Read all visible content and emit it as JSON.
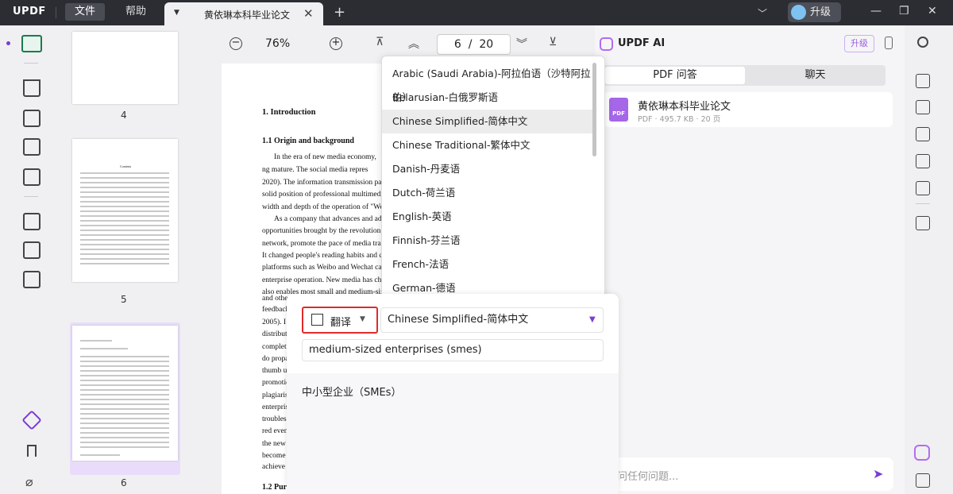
{
  "app": {
    "logo": "UPDF",
    "menu_file": "文件",
    "menu_help": "帮助",
    "tab_title": "黄依琳本科毕业论文",
    "upgrade": "升级"
  },
  "toolbar": {
    "zoom": "76%",
    "page_current": "6",
    "page_sep": "/",
    "page_total": "20"
  },
  "thumbnails": [
    {
      "num": "4"
    },
    {
      "num": "5"
    },
    {
      "num": "6"
    }
  ],
  "thumb5_title": "Contents",
  "document": {
    "heading1": "1. Introduction",
    "heading11": "1.1 Origin and background",
    "heading12": "1.2 Pur",
    "lines": [
      "In the era of new media economy,",
      "ng mature. The social media repres",
      "2020). The information transmission patte",
      "solid position of professional multimedia",
      "width and depth of the operation of \"We me",
      "As a company that advances and adv",
      "opportunities brought by the revolution, rel",
      "network, promote the pace of media transf",
      "It changed people's reading habits and creat",
      "platforms such as Weibo and Wechat ca",
      "enterprise operation. New media has chang",
      "also enables most small and medium-sized",
      "feedback",
      "and othe",
      "2005). I",
      "distribut",
      "complete",
      "do propa",
      "thumb up",
      "promotic",
      "plagiaris",
      "enterpris",
      "troubles,",
      "red even",
      "the new",
      "become",
      "achieve s"
    ]
  },
  "dropdown": {
    "options": [
      "Arabic (Saudi Arabia)-阿拉伯语（沙特阿拉伯）",
      "Belarusian-白俄罗斯语",
      "Chinese Simplified-简体中文",
      "Chinese Traditional-繁体中文",
      "Danish-丹麦语",
      "Dutch-荷兰语",
      "English-英语",
      "Finnish-芬兰语",
      "French-法语",
      "German-德语"
    ],
    "selected_index": 2
  },
  "translate": {
    "mode_label": "翻译",
    "language": "Chinese Simplified-简体中文",
    "source_text": "medium-sized enterprises (smes)",
    "result_text": "中小型企业（SMEs）"
  },
  "ai": {
    "title": "UPDF AI",
    "upgrade": "升级",
    "tab_pdf_qa": "PDF 问答",
    "tab_chat": "聊天",
    "file_name": "黄依琳本科毕业论文",
    "file_meta": "PDF · 495.7 KB · 20 页",
    "input_placeholder": "问任何问题..."
  },
  "colors": {
    "accent": "#7a3bd6",
    "highlight_border": "#e12a2a",
    "active_tool": "#1a7b4e",
    "titlebar": "#2b2d33"
  }
}
